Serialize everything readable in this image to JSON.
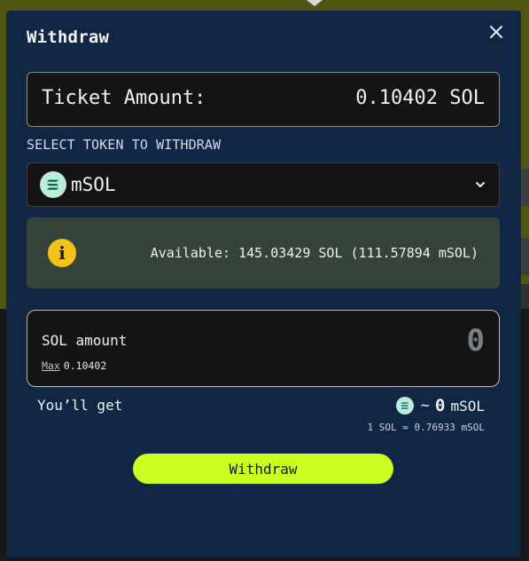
{
  "modal": {
    "title": "Withdraw",
    "close_icon": "close-icon"
  },
  "ticket": {
    "label": "Ticket Amount:",
    "value": "0.10402 SOL"
  },
  "token_select": {
    "section_label": "SELECT TOKEN TO WITHDRAW",
    "selected": "mSOL",
    "icon": "solana-token-icon",
    "chevron_icon": "chevron-down-icon"
  },
  "info": {
    "icon": "info-icon",
    "text": "Available: 145.03429 SOL (111.57894 mSOL)"
  },
  "amount": {
    "label": "SOL amount",
    "placeholder": "0",
    "max_label": "Max",
    "max_value": "0.10402"
  },
  "receive": {
    "label": "You’ll get",
    "approx": "~",
    "value": "0",
    "unit": "mSOL",
    "rate": "1 SOL ≈ 0.76933 mSOL"
  },
  "actions": {
    "withdraw_label": "Withdraw"
  },
  "colors": {
    "modal_bg": "#0f2744",
    "accent": "#cbff1f",
    "info_bg": "#35433b",
    "info_icon": "#f2c21b",
    "token_icon_bg": "#b9ecd9"
  }
}
